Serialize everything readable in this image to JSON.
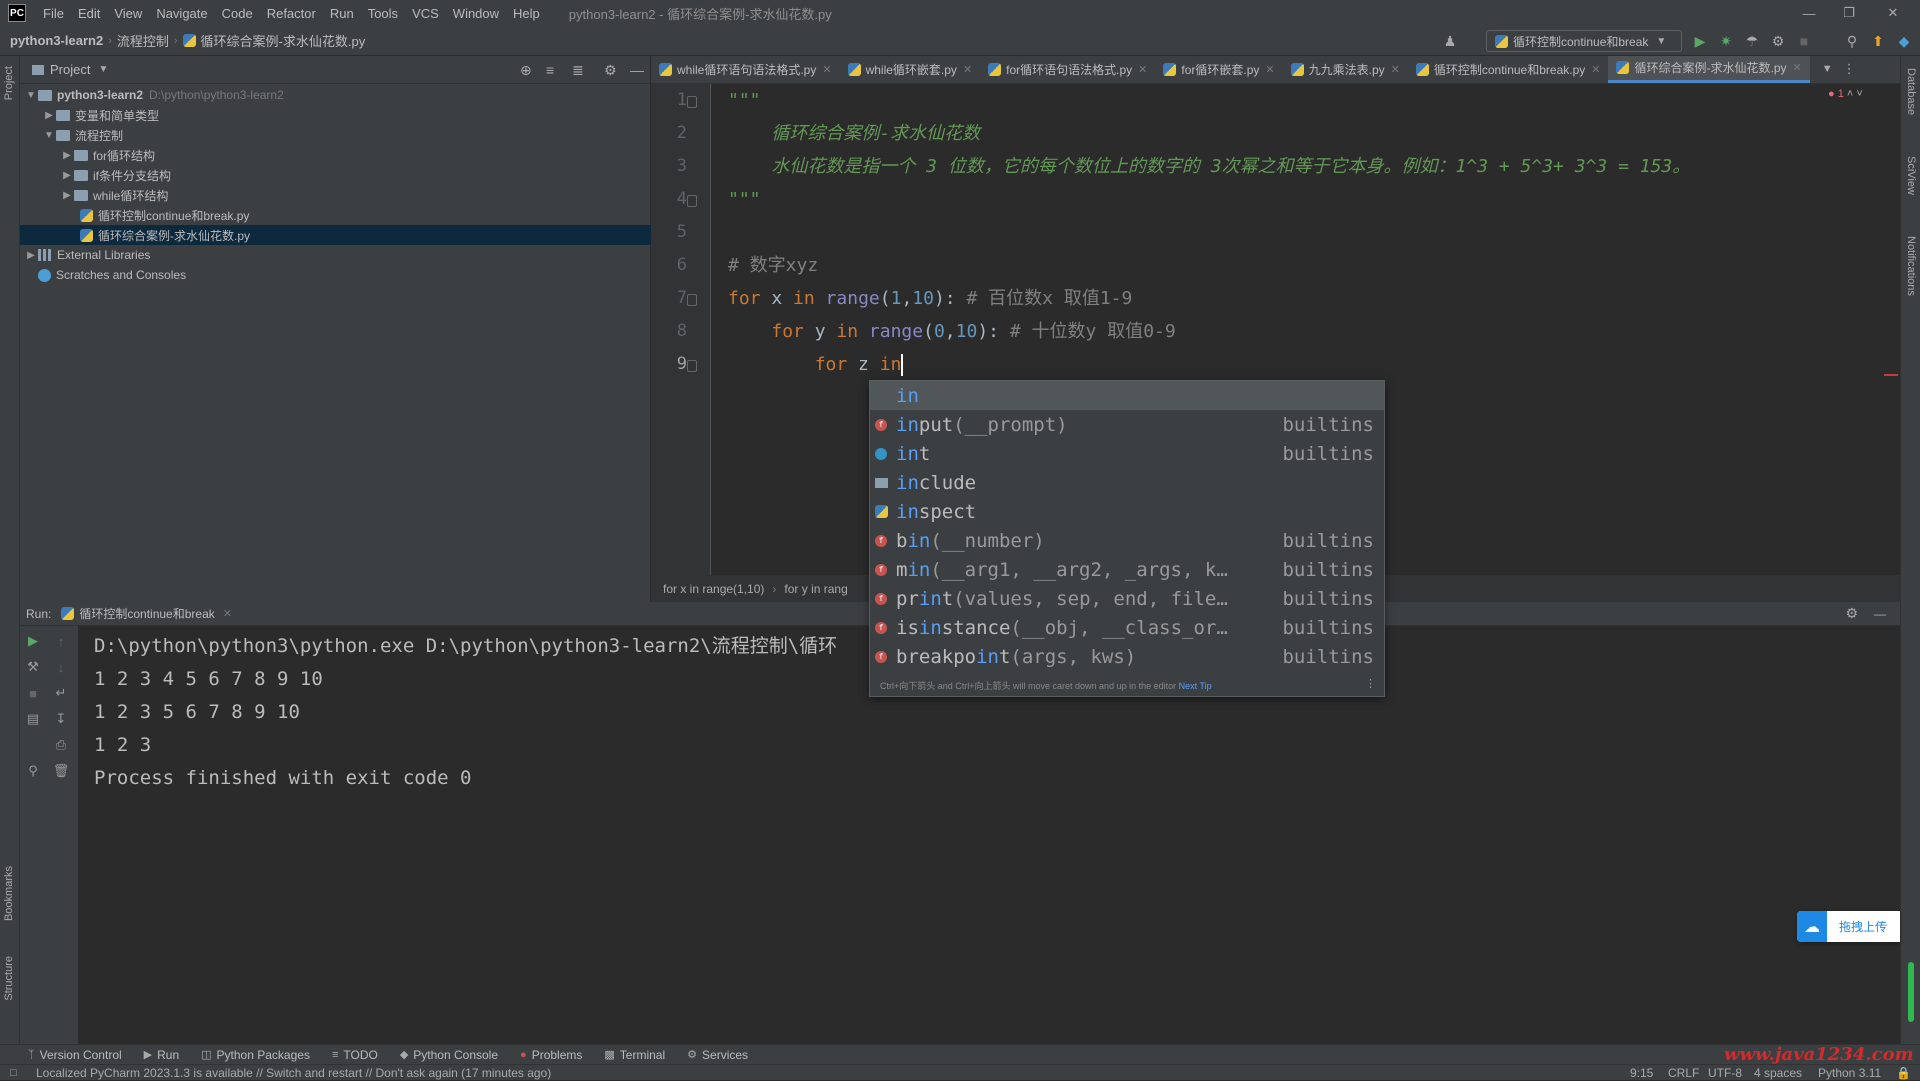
{
  "menubar": {
    "logo": "PC",
    "items": [
      "File",
      "Edit",
      "View",
      "Navigate",
      "Code",
      "Refactor",
      "Run",
      "Tools",
      "VCS",
      "Window",
      "Help"
    ],
    "window_title": "python3-learn2 - 循环综合案例-求水仙花数.py"
  },
  "navbar": {
    "crumbs": [
      "python3-learn2",
      "流程控制",
      "循环综合案例-求水仙花数.py"
    ],
    "run_config": "循环控制continue和break"
  },
  "project": {
    "header": "Project",
    "tree": [
      {
        "label": "python3-learn2",
        "path": "D:\\python\\python3-learn2",
        "kind": "folder",
        "depth": 0,
        "open": true
      },
      {
        "label": "变量和简单类型",
        "kind": "folder",
        "depth": 1,
        "open": false
      },
      {
        "label": "流程控制",
        "kind": "folder",
        "depth": 1,
        "open": true
      },
      {
        "label": "for循环结构",
        "kind": "folder",
        "depth": 2,
        "open": false
      },
      {
        "label": "if条件分支结构",
        "kind": "folder",
        "depth": 2,
        "open": false
      },
      {
        "label": "while循环结构",
        "kind": "folder",
        "depth": 2,
        "open": false
      },
      {
        "label": "循环控制continue和break.py",
        "kind": "py",
        "depth": 3
      },
      {
        "label": "循环综合案例-求水仙花数.py",
        "kind": "py",
        "depth": 3,
        "selected": true
      },
      {
        "label": "External Libraries",
        "kind": "lib",
        "depth": 0,
        "open": false
      },
      {
        "label": "Scratches and Consoles",
        "kind": "scratch",
        "depth": 0
      }
    ]
  },
  "editor": {
    "tabs": [
      "while循环语句语法格式.py",
      "while循环嵌套.py",
      "for循环语句语法格式.py",
      "for循环嵌套.py",
      "九九乘法表.py",
      "循环控制continue和break.py",
      "循环综合案例-求水仙花数.py"
    ],
    "active_tab": 6,
    "error_count": "1",
    "line_numbers": [
      "1",
      "2",
      "3",
      "4",
      "5",
      "6",
      "7",
      "8",
      "9"
    ],
    "lines": {
      "l1": "\"\"\"",
      "l2": "    循环综合案例-求水仙花数",
      "l3": "    水仙花数是指一个 3 位数，它的每个数位上的数字的 3次幂之和等于它本身。例如：1^3 + 5^3+ 3^3 = 153。",
      "l4": "\"\"\"",
      "l6": "# 数字xyz",
      "l7": {
        "kw1": "for",
        "v": " x ",
        "kw2": "in",
        "fn": " range",
        "p1": "(",
        "n1": "1",
        "c": ",",
        "n2": "10",
        "p2": "): ",
        "cm": "# 百位数x 取值1-9"
      },
      "l8": {
        "indent": "    ",
        "kw1": "for",
        "v": " y ",
        "kw2": "in",
        "fn": " range",
        "p1": "(",
        "n1": "0",
        "c": ",",
        "n2": "10",
        "p2": "): ",
        "cm": "# 十位数y 取值0-9"
      },
      "l9": {
        "indent": "        ",
        "kw1": "for",
        "v": " z ",
        "kw2": "in"
      }
    },
    "breadcrumb": [
      "for x in range(1,10)",
      "for y in rang"
    ]
  },
  "completion": {
    "items": [
      {
        "pre": "",
        "m": "in",
        "post": "",
        "params": "",
        "src": "",
        "icon": "none"
      },
      {
        "pre": "",
        "m": "in",
        "post": "put",
        "params": "(__prompt)",
        "src": "builtins",
        "icon": "red"
      },
      {
        "pre": "",
        "m": "in",
        "post": "t",
        "params": "",
        "src": "builtins",
        "icon": "blue"
      },
      {
        "pre": "",
        "m": "in",
        "post": "clude",
        "params": "",
        "src": "",
        "icon": "folder"
      },
      {
        "pre": "",
        "m": "in",
        "post": "spect",
        "params": "",
        "src": "",
        "icon": "py"
      },
      {
        "pre": "b",
        "m": "in",
        "post": "",
        "params": "(__number)",
        "src": "builtins",
        "icon": "red"
      },
      {
        "pre": "m",
        "m": "in",
        "post": "",
        "params": "(__arg1, __arg2, _args, k…",
        "src": "builtins",
        "icon": "red"
      },
      {
        "pre": "pr",
        "m": "in",
        "post": "t",
        "params": "(values, sep, end, file…",
        "src": "builtins",
        "icon": "red"
      },
      {
        "pre": "is",
        "m": "in",
        "post": "stance",
        "params": "(__obj, __class_or…",
        "src": "builtins",
        "icon": "red"
      },
      {
        "pre": "breakpo",
        "m": "in",
        "post": "t",
        "params": "(args, kws)",
        "src": "builtins",
        "icon": "red"
      }
    ],
    "tip": "Ctrl+向下箭头 and Ctrl+向上箭头 will move caret down and up in the editor",
    "tip_link": "Next Tip"
  },
  "run": {
    "label": "Run:",
    "tab": "循环控制continue和break",
    "console": [
      "D:\\python\\python3\\python.exe D:\\python\\python3-learn2\\流程控制\\循环",
      "1 2 3 4 5 6 7 8 9 10",
      "1 2 3 5 6 7 8 9 10",
      "1 2 3",
      "",
      "Process finished with exit code 0"
    ]
  },
  "side": {
    "left_top": "Project",
    "left_bookmarks": "Bookmarks",
    "left_structure": "Structure",
    "right_db": "Database",
    "right_sciview": "SciView",
    "right_notifications": "Notifications"
  },
  "upload_button": "拖拽上传",
  "tool_tabs": [
    "Version Control",
    "Run",
    "Python Packages",
    "TODO",
    "Python Console",
    "Problems",
    "Terminal",
    "Services"
  ],
  "status": {
    "message": "Localized PyCharm 2023.1.3 is available // Switch and restart // Don't ask again (17 minutes ago)",
    "position": "9:15",
    "line_sep": "CRLF",
    "encoding": "UTF-8",
    "indent": "4 spaces",
    "interpreter": "Python 3.11"
  },
  "watermark": "www.java1234.com"
}
